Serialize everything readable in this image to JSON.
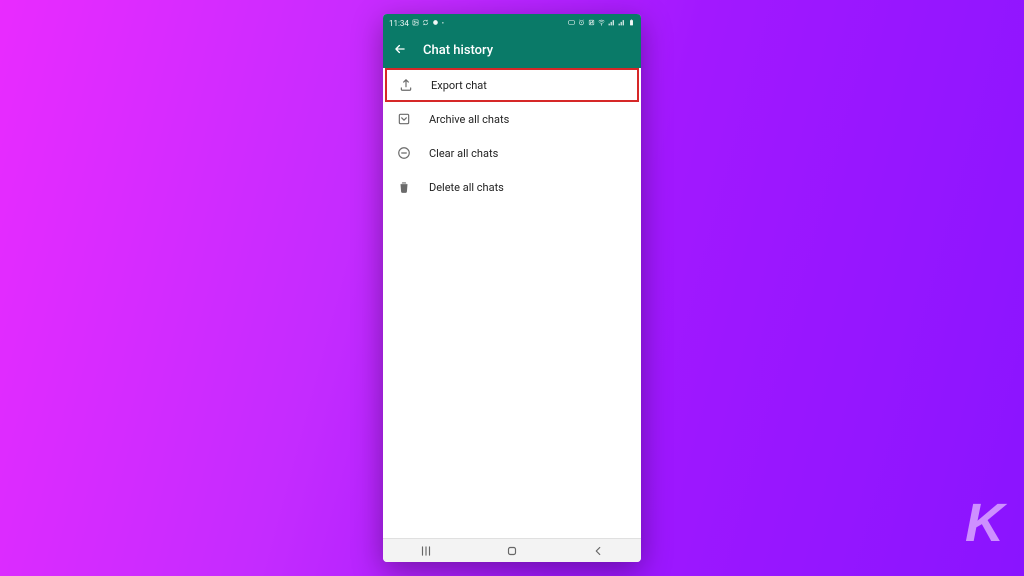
{
  "status": {
    "time": "11:34",
    "left_icons": [
      "image-icon",
      "cycle-icon",
      "badge-icon"
    ],
    "right_icons": [
      "hd-icon",
      "alarm-icon",
      "nfc-icon",
      "wifi-icon",
      "signal-icon",
      "signal-icon",
      "battery-icon"
    ]
  },
  "header": {
    "title": "Chat history"
  },
  "menu": {
    "items": [
      {
        "icon": "export-icon",
        "label": "Export chat",
        "highlighted": true
      },
      {
        "icon": "archive-icon",
        "label": "Archive all chats",
        "highlighted": false
      },
      {
        "icon": "clear-icon",
        "label": "Clear all chats",
        "highlighted": false
      },
      {
        "icon": "delete-icon",
        "label": "Delete all chats",
        "highlighted": false
      }
    ]
  },
  "nav": {
    "buttons": [
      "recents",
      "home",
      "back"
    ]
  },
  "watermark": "K",
  "colors": {
    "brand_green": "#0a7a68",
    "highlight_red": "#d62828"
  }
}
